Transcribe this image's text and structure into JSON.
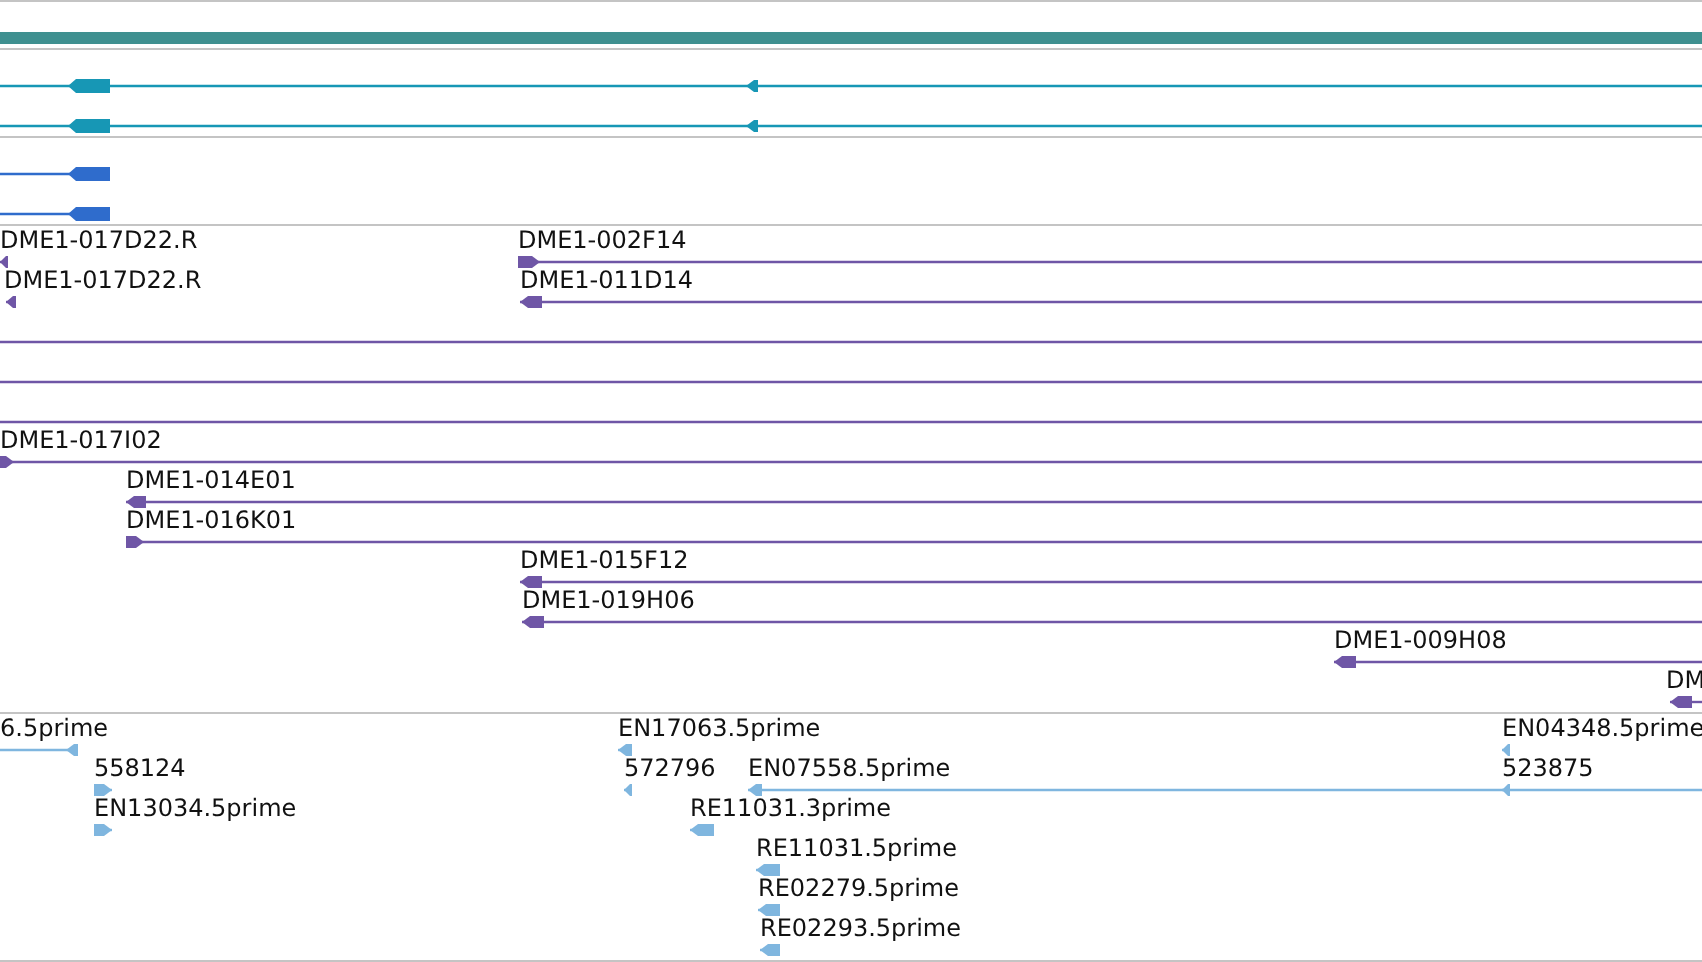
{
  "tracks": [
    {
      "kind": "contig",
      "color": "#3f9090"
    },
    {
      "kind": "features",
      "color": "#1797b5",
      "lanes": [
        {
          "features": [
            {
              "kind": "arrow",
              "reverse": true
            }
          ]
        },
        {
          "features": [
            {
              "kind": "arrow",
              "reverse": true
            }
          ]
        }
      ]
    },
    {
      "kind": "features",
      "color": "#2f6ccc",
      "lanes": [
        {
          "features": [
            {
              "kind": "arrow",
              "reverse": true
            }
          ]
        },
        {
          "features": [
            {
              "kind": "arrow",
              "reverse": true
            }
          ]
        }
      ]
    },
    {
      "kind": "features",
      "color": "#6f56a6",
      "lanes": [
        {
          "features": [
            {
              "kind": "arrow",
              "label": "DME1-017D22.R",
              "reverse": true
            },
            {
              "kind": "arrow",
              "label": "DME1-002F14",
              "reverse": false
            }
          ]
        },
        {
          "features": [
            {
              "kind": "arrow",
              "label": "DME1-017D22.R",
              "reverse": true
            },
            {
              "kind": "arrow",
              "label": "DME1-011D14",
              "reverse": true
            }
          ]
        },
        {
          "features": [
            {
              "kind": "line"
            }
          ]
        },
        {
          "features": [
            {
              "kind": "line"
            }
          ]
        },
        {
          "features": [
            {
              "kind": "line"
            }
          ]
        },
        {
          "features": [
            {
              "kind": "arrow",
              "label": "DME1-017I02",
              "reverse": false
            }
          ]
        },
        {
          "features": [
            {
              "kind": "arrow",
              "label": "DME1-014E01",
              "reverse": true
            }
          ]
        },
        {
          "features": [
            {
              "kind": "arrow",
              "label": "DME1-016K01",
              "reverse": false
            }
          ]
        },
        {
          "features": [
            {
              "kind": "arrow",
              "label": "DME1-015F12",
              "reverse": true
            }
          ]
        },
        {
          "features": [
            {
              "kind": "arrow",
              "label": "DME1-019H06",
              "reverse": true
            }
          ]
        },
        {
          "features": [
            {
              "kind": "arrow",
              "label": "DME1-009H08",
              "reverse": true
            }
          ]
        },
        {
          "features": [
            {
              "kind": "arrow",
              "label": "DM",
              "reverse": true
            }
          ]
        }
      ]
    },
    {
      "kind": "features",
      "color": "#7fb6df",
      "lanes": [
        {
          "features": [
            {
              "kind": "arrow",
              "label": "6.5prime",
              "reverse": true
            },
            {
              "kind": "arrow",
              "label": "EN17063.5prime",
              "reverse": true
            },
            {
              "kind": "arrow",
              "label": "EN04348.5prime",
              "reverse": true
            }
          ]
        },
        {
          "features": [
            {
              "kind": "arrow",
              "label": "558124",
              "reverse": false
            },
            {
              "kind": "arrow",
              "label": "572796",
              "reverse": true
            },
            {
              "kind": "arrow",
              "label": "EN07558.5prime",
              "reverse": true
            },
            {
              "kind": "arrow",
              "label": "523875",
              "reverse": true
            }
          ]
        },
        {
          "features": [
            {
              "kind": "arrow",
              "label": "EN13034.5prime",
              "reverse": false
            },
            {
              "kind": "arrow",
              "label": "RE11031.3prime",
              "reverse": true
            }
          ]
        },
        {
          "features": [
            {
              "kind": "arrow",
              "label": "RE11031.5prime",
              "reverse": true
            }
          ]
        },
        {
          "features": [
            {
              "kind": "arrow",
              "label": "RE02279.5prime",
              "reverse": true
            }
          ]
        },
        {
          "features": [
            {
              "kind": "arrow",
              "label": "RE02293.5prime",
              "reverse": true
            }
          ]
        }
      ]
    }
  ]
}
